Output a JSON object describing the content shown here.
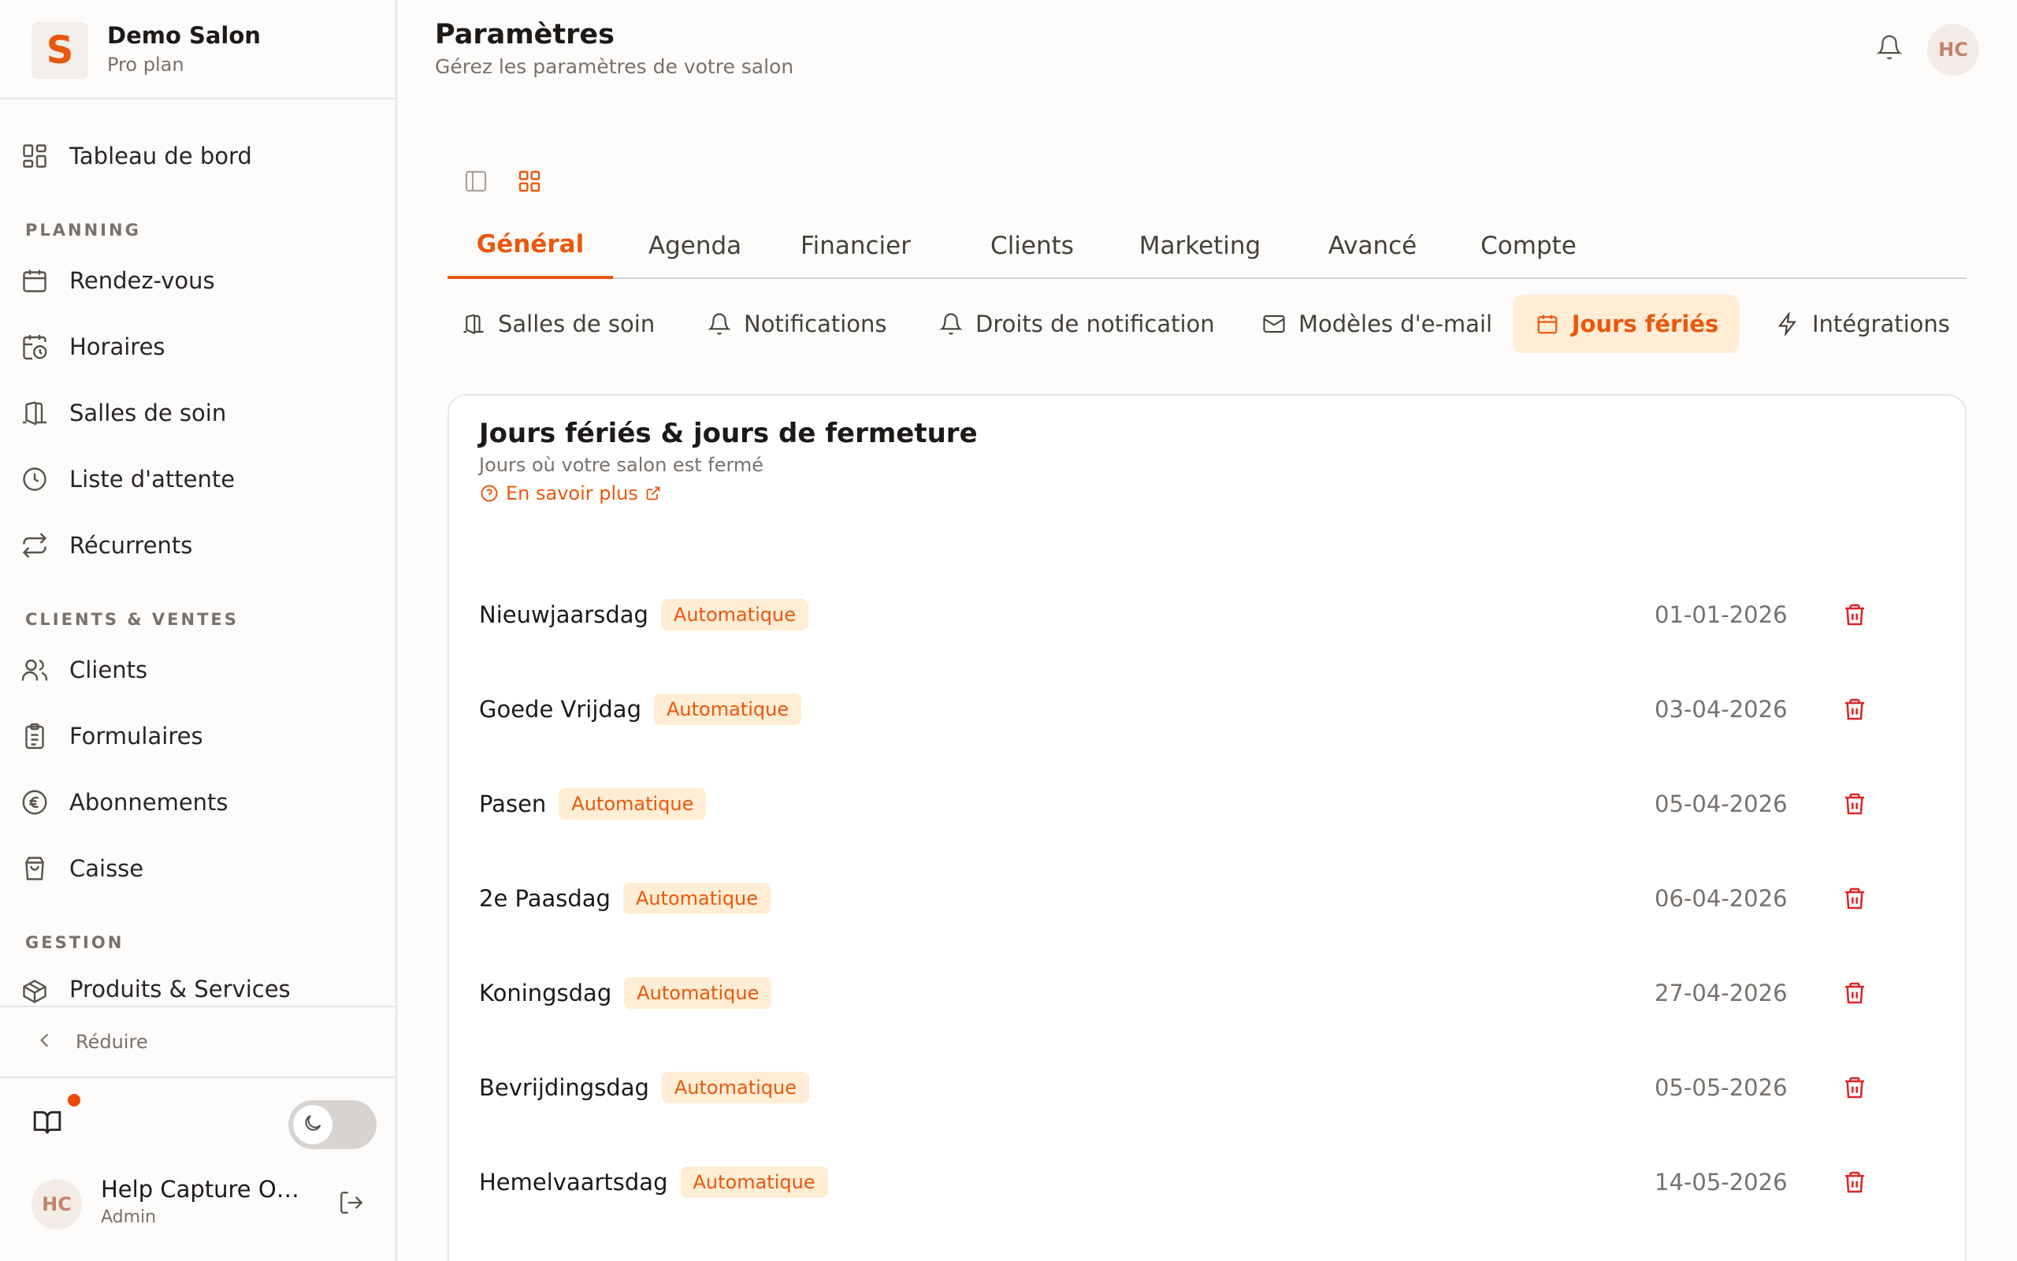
{
  "brand": {
    "logo_letter": "S",
    "name": "Demo Salon",
    "plan": "Pro plan"
  },
  "sidebar": {
    "dashboard": "Tableau de bord",
    "sections": [
      {
        "label": "PLANNING",
        "items": [
          "Rendez-vous",
          "Horaires",
          "Salles de soin",
          "Liste d'attente",
          "Récurrents"
        ]
      },
      {
        "label": "CLIENTS & VENTES",
        "items": [
          "Clients",
          "Formulaires",
          "Abonnements",
          "Caisse"
        ]
      },
      {
        "label": "GESTION",
        "items": [
          "Produits & Services"
        ]
      }
    ],
    "collapse_label": "Réduire"
  },
  "user": {
    "initials": "HC",
    "name": "Help Capture Ow...",
    "role": "Admin"
  },
  "header": {
    "title": "Paramètres",
    "subtitle": "Gérez les paramètres de votre salon",
    "avatar_initials": "HC"
  },
  "tabs": [
    "Général",
    "Agenda",
    "Financier",
    "Clients",
    "Marketing",
    "Avancé",
    "Compte"
  ],
  "active_tab": "Général",
  "subtabs": [
    "Salles de soin",
    "Notifications",
    "Droits de notification",
    "Modèles d'e-mail",
    "Jours fériés",
    "Intégrations"
  ],
  "active_subtab": "Jours fériés",
  "card": {
    "title": "Jours fériés & jours de fermeture",
    "subtitle": "Jours où votre salon est fermé",
    "learn_more": "En savoir plus"
  },
  "holidays": [
    {
      "name": "Nieuwjaarsdag",
      "badge": "Automatique",
      "date": "01-01-2026"
    },
    {
      "name": "Goede Vrijdag",
      "badge": "Automatique",
      "date": "03-04-2026"
    },
    {
      "name": "Pasen",
      "badge": "Automatique",
      "date": "05-04-2026"
    },
    {
      "name": "2e Paasdag",
      "badge": "Automatique",
      "date": "06-04-2026"
    },
    {
      "name": "Koningsdag",
      "badge": "Automatique",
      "date": "27-04-2026"
    },
    {
      "name": "Bevrijdingsdag",
      "badge": "Automatique",
      "date": "05-05-2026"
    },
    {
      "name": "Hemelvaartsdag",
      "badge": "Automatique",
      "date": "14-05-2026"
    }
  ],
  "colors": {
    "accent": "#ea580c",
    "danger": "#dc2626",
    "badge_bg": "#ffedd5"
  }
}
